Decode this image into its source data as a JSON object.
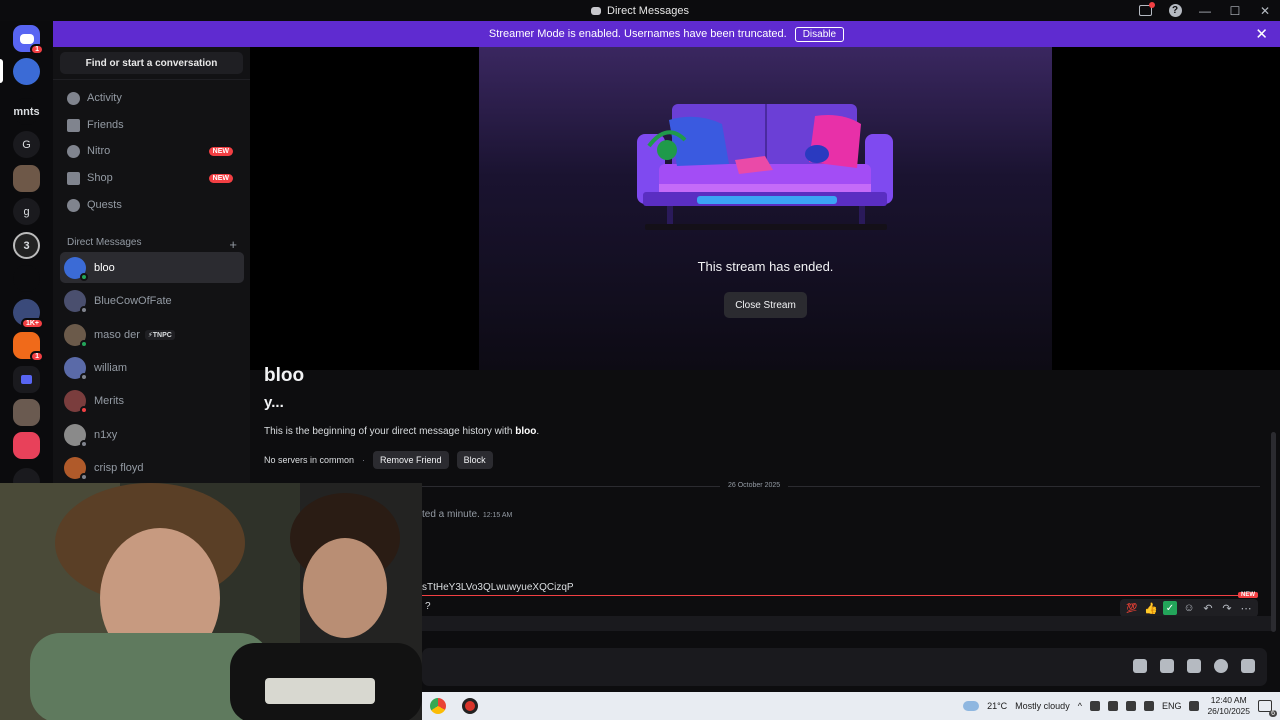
{
  "window": {
    "title": "Direct Messages"
  },
  "banner": {
    "text": "Streamer Mode is enabled. Usernames have been truncated.",
    "button": "Disable"
  },
  "guilds": [
    {
      "label": "",
      "badge": "1"
    },
    {
      "label": "",
      "badge": ""
    },
    {
      "label": "mnts",
      "badge": ""
    },
    {
      "label": "G",
      "badge": ""
    },
    {
      "label": "",
      "badge": ""
    },
    {
      "label": "g",
      "badge": ""
    },
    {
      "label": "3",
      "badge": ""
    },
    {
      "label": "",
      "badge": ""
    },
    {
      "label": "",
      "badge": "1K+"
    },
    {
      "label": "",
      "badge": "1"
    },
    {
      "label": "",
      "badge": ""
    },
    {
      "label": "",
      "badge": ""
    },
    {
      "label": "",
      "badge": ""
    },
    {
      "label": "",
      "badge": ""
    }
  ],
  "sidebar": {
    "search": "Find or start a conversation",
    "nav": [
      {
        "label": "Activity",
        "badge": ""
      },
      {
        "label": "Friends",
        "badge": ""
      },
      {
        "label": "Nitro",
        "badge": "NEW"
      },
      {
        "label": "Shop",
        "badge": "NEW"
      },
      {
        "label": "Quests",
        "badge": ""
      }
    ],
    "dm_header": "Direct Messages",
    "dms": [
      {
        "name": "bloo",
        "tag": "",
        "color": "#3b6bd6",
        "status": "on"
      },
      {
        "name": "BlueCowOfFate",
        "tag": "",
        "color": "#4a4f6e",
        "status": "off"
      },
      {
        "name": "maso der",
        "tag": "⚡TNPC",
        "color": "#6b5a4a",
        "status": "on"
      },
      {
        "name": "william",
        "tag": "",
        "color": "#5a6aa8",
        "status": "off"
      },
      {
        "name": "Merits",
        "tag": "",
        "color": "#7a3d3d",
        "status": "dnd"
      },
      {
        "name": "n1xy",
        "tag": "",
        "color": "#8a8a8a",
        "status": "off"
      },
      {
        "name": "crisp floyd",
        "tag": "",
        "color": "#b05a2a",
        "status": "off"
      }
    ]
  },
  "stream": {
    "ended_text": "This stream has ended.",
    "close_button": "Close Stream"
  },
  "chat": {
    "username": "bloo",
    "subtitle": "y...",
    "beginning_prefix": "This is the beginning of your direct message history with ",
    "beginning_name": "bloo",
    "no_servers": "No servers in common",
    "dot": "·",
    "remove_friend": "Remove Friend",
    "block": "Block",
    "date_divider": "26 October 2025",
    "msg1_text": "ted a minute.",
    "msg1_time": "12:15 AM",
    "msg2_text": "sTtHeY3LVo3QLwuwyueXQCizqP",
    "new_tag": "NEW",
    "msg3_text": "?"
  },
  "taskbar": {
    "weather": "21°C",
    "weather_desc": "Mostly cloudy",
    "lang": "ENG",
    "time": "12:40 AM",
    "date": "26/10/2025",
    "notif_count": "6"
  }
}
